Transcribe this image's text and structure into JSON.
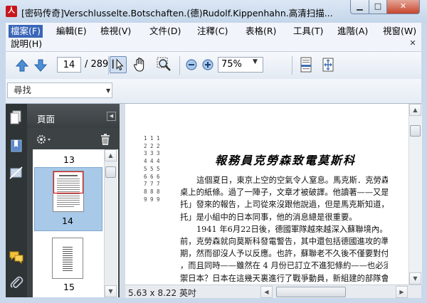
{
  "window": {
    "title": "[密码传奇]Verschlusselte.Botschaften.(德)Rudolf.Kippenhahn.高清扫描...",
    "app_icon": "acrobat-reader-icon"
  },
  "menubar": {
    "items": [
      "檔案(F)",
      "編輯(E)",
      "檢視(V)",
      "文件(D)",
      "注釋(C)",
      "表格(R)",
      "工具(T)",
      "進階(A)",
      "視窗(W)",
      "說明(H)"
    ]
  },
  "toolbar": {
    "current_page": "14",
    "total_pages": "/ 289",
    "zoom": "75%"
  },
  "findbar": {
    "label": "尋找"
  },
  "pages_panel": {
    "title": "頁面",
    "thumbnails": [
      {
        "label": "13"
      },
      {
        "label": "14",
        "selected": true
      },
      {
        "label": "15"
      }
    ]
  },
  "document": {
    "page_size": "5.63 x 8.22 英吋",
    "line_numbers": "1 1 1\n2 2 2\n3 3 3\n4 4 4\n5 5 5\n6 6 6\n7 7 7\n8 8 8\n9 9 9",
    "heading": "報務員克勞森致電莫斯科",
    "paragraphs": [
      "這個夏日，東京上空的空氣令人窒息。馬克斯．克勞森看著",
      "桌上的紙條。過了一陣子，文章才被破譯。他讀著——又是「奧",
      "托」發來的報告，上司從來沒跟他說過，但是馬克斯知道，「奧",
      "托」是小組中的日本同事，他的消息總是很重要。",
      "1941 年6月22日後，德國軍隊越來越深入蘇聯境內。很久以",
      "前，克勞森就向莫斯科發電警告，其中還包括德國進攻的準備日",
      "期，然而卻沒人予以反應。也許，蘇聯老不久後不僅要對付德國",
      "，而且同時——雖然在 4 月份已訂立不進犯條約——也必須防",
      "禦日本？日本在這幾天裏進行了戰爭動員，新組建的部隊會被調"
    ]
  }
}
